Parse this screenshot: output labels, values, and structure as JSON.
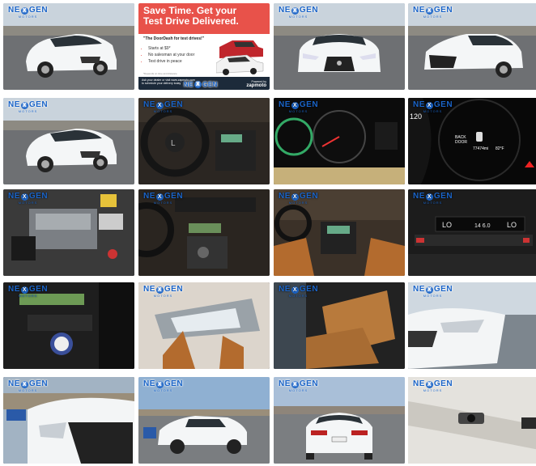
{
  "logo": {
    "brand_left": "NE",
    "brand_mark": "X",
    "brand_right": "GEN",
    "sub": "MOTORS"
  },
  "ad": {
    "headline": "Save Time. Get your Test Drive Delivered.",
    "headline_line1": "Save Time. Get your",
    "headline_line2": "Test Drive Delivered.",
    "tagline": "\"The DoorDash for test drives!\"",
    "bullets": [
      "Starts at $9*",
      "No salesman at your door",
      "Test drive in peace"
    ],
    "footer_line1": "Ask your dealer or visit www.zapmoto.com",
    "footer_line2": "to schedule your delivery today",
    "powered_by": "Powered by",
    "powered_brand": "zapmoto",
    "note": "*Depends on time and distance"
  },
  "dashboard": {
    "back_door": "BACK",
    "door": "DOOR",
    "odometer": "77474mi",
    "temp": "82°F",
    "speed_120": "120"
  },
  "climate": {
    "readout_lo": "LO",
    "readout_hi": "14 6.0",
    "readout_temp": "LO"
  },
  "tiles": [
    {
      "name": "photo-front-left-exterior"
    },
    {
      "name": "zapmoto-ad"
    },
    {
      "name": "photo-front-exterior"
    },
    {
      "name": "photo-front-right-exterior"
    },
    {
      "name": "photo-front-left-close"
    },
    {
      "name": "photo-steering-wheel"
    },
    {
      "name": "photo-instrument-cluster"
    },
    {
      "name": "photo-odometer"
    },
    {
      "name": "photo-engine-bay"
    },
    {
      "name": "photo-center-console"
    },
    {
      "name": "photo-interior-dash"
    },
    {
      "name": "photo-climate-control"
    },
    {
      "name": "photo-audio-controls"
    },
    {
      "name": "photo-sunroof"
    },
    {
      "name": "photo-seat"
    },
    {
      "name": "photo-headlight"
    },
    {
      "name": "photo-front-grille"
    },
    {
      "name": "photo-rear-left-exterior"
    },
    {
      "name": "photo-rear-exterior"
    },
    {
      "name": "photo-backup-camera"
    }
  ]
}
